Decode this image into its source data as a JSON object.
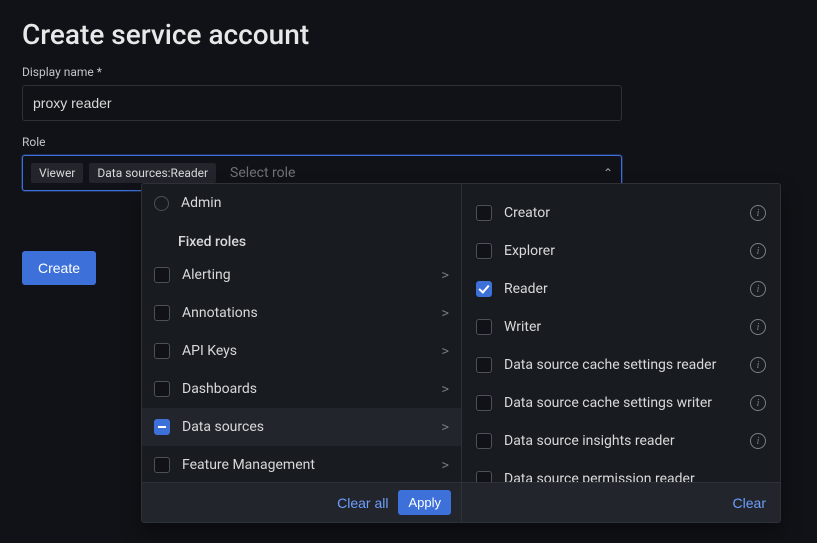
{
  "title": "Create service account",
  "displayName": {
    "label": "Display name *",
    "value": "proxy reader"
  },
  "role": {
    "label": "Role",
    "chips": [
      "Viewer",
      "Data sources:Reader"
    ],
    "placeholder": "Select role"
  },
  "createButton": "Create",
  "dropdown": {
    "admin": "Admin",
    "fixedRolesHeading": "Fixed roles",
    "categories": [
      {
        "label": "Alerting",
        "state": "unchecked"
      },
      {
        "label": "Annotations",
        "state": "unchecked"
      },
      {
        "label": "API Keys",
        "state": "unchecked"
      },
      {
        "label": "Dashboards",
        "state": "unchecked"
      },
      {
        "label": "Data sources",
        "state": "indeterminate",
        "selected": true
      },
      {
        "label": "Feature Management",
        "state": "unchecked"
      }
    ],
    "subroles": [
      {
        "label": "Creator",
        "checked": false
      },
      {
        "label": "Explorer",
        "checked": false
      },
      {
        "label": "Reader",
        "checked": true
      },
      {
        "label": "Writer",
        "checked": false
      },
      {
        "label": "Data source cache settings reader",
        "checked": false
      },
      {
        "label": "Data source cache settings writer",
        "checked": false
      },
      {
        "label": "Data source insights reader",
        "checked": false
      },
      {
        "label": "Data source permission reader",
        "checked": false
      }
    ],
    "clearAll": "Clear all",
    "apply": "Apply",
    "clear": "Clear"
  }
}
